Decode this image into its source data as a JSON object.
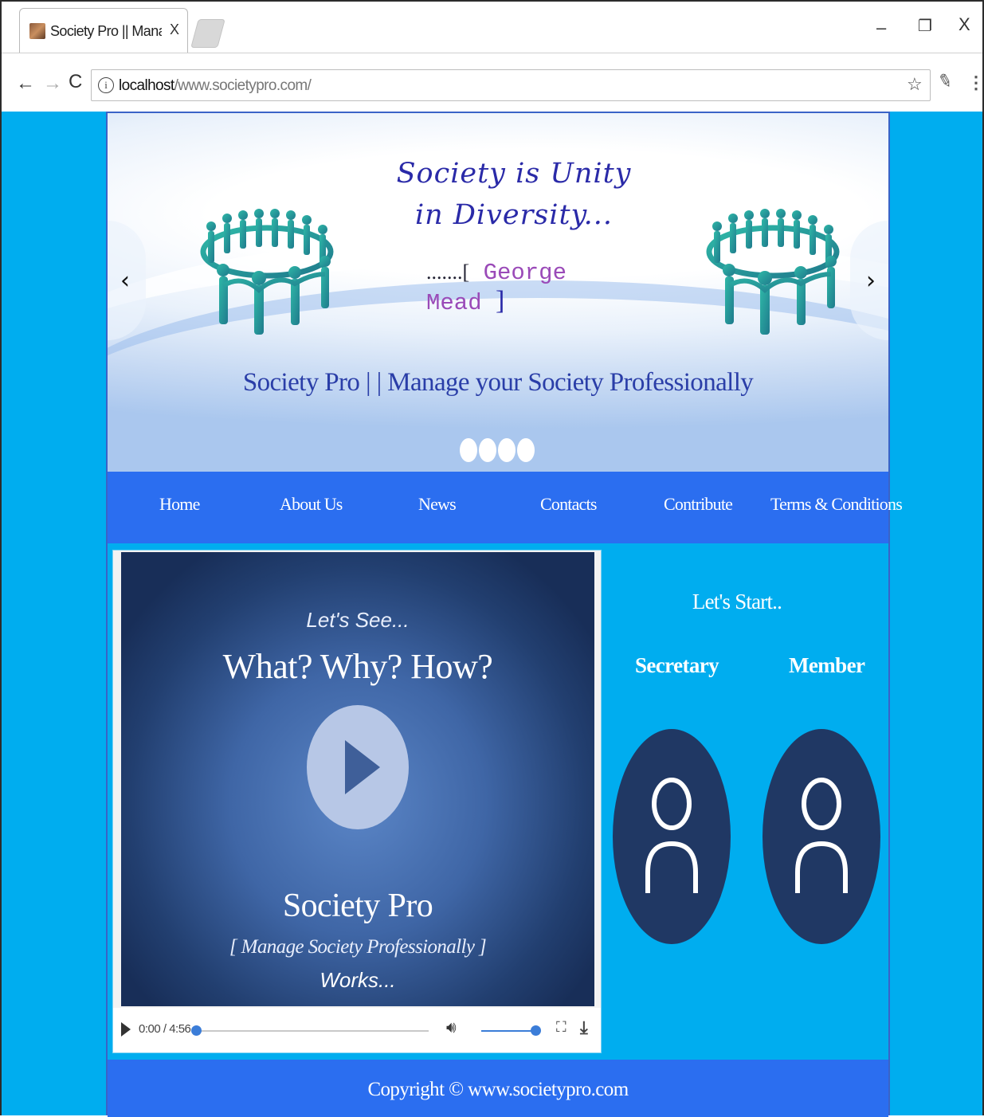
{
  "browser": {
    "tab_title": "Society Pro || Manage Yo",
    "tab_close": "X",
    "window_controls": {
      "minimize": "–",
      "restore": "❐",
      "close": "X"
    },
    "url_host": "localhost",
    "url_path": "/www.societypro.com/",
    "icons": [
      "back-icon",
      "forward-icon",
      "reload-icon",
      "info-icon",
      "star-icon",
      "extension-icon",
      "menu-icon"
    ]
  },
  "carousel": {
    "quote": "Society is Unity in Diversity...",
    "author_prefix": ".......[",
    "author_name": " George Mead ",
    "author_suffix": "]",
    "caption": "Society Pro | | Manage your Society Professionally",
    "prev_glyph": "‹",
    "next_glyph": "›",
    "slide_count": 4
  },
  "nav": {
    "items": [
      "Home",
      "About Us",
      "News",
      "Contacts",
      "Contribute",
      "Terms & Conditions"
    ]
  },
  "video": {
    "poster_line1": "Let's See...",
    "poster_line2": "What? Why? How?",
    "poster_line3": "Society Pro",
    "poster_line4": "[ Manage Society Professionally ]",
    "poster_line5": "Works...",
    "time": "0:00 / 4:56",
    "progress": 0,
    "volume": 1.0
  },
  "start": {
    "title": "Let's Start..",
    "roles": [
      "Secretary",
      "Member"
    ]
  },
  "footer": {
    "copyright": "Copyright © www.societypro.com"
  },
  "colors": {
    "page_bg": "#00adef",
    "nav_bg": "#2b6ef0",
    "avatar_bg": "#203864",
    "quote_text": "#2a2aa8"
  }
}
